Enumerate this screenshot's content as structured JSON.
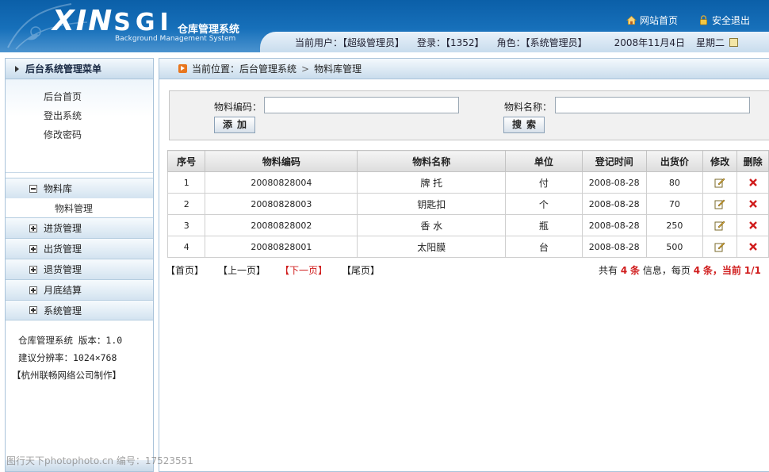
{
  "header": {
    "logo_mark": "XIN",
    "logo_mark_2": "SGI",
    "logo_sub": "Background Management System",
    "logo_cn": "仓库管理系统",
    "nav": {
      "home": "网站首页",
      "logout": "安全退出"
    },
    "info": {
      "user": "当前用户：【超级管理员】",
      "login": "登录：【1352】",
      "role": "角色：【系统管理员】",
      "date": "2008年11月4日",
      "weekday": "星期二"
    }
  },
  "sidebar": {
    "title": "后台系统管理菜单",
    "quick_links": [
      "后台首页",
      "登出系统",
      "修改密码"
    ],
    "menu": [
      {
        "label": "物料库",
        "expanded": true,
        "children": [
          "物料管理"
        ]
      },
      {
        "label": "进货管理",
        "expanded": false
      },
      {
        "label": "出货管理",
        "expanded": false
      },
      {
        "label": "退货管理",
        "expanded": false
      },
      {
        "label": "月底结算",
        "expanded": false
      },
      {
        "label": "系统管理",
        "expanded": false
      }
    ],
    "footer": [
      "仓库管理系统 版本：1.0",
      "建议分辨率：1024×768",
      "【杭州联畅网络公司制作】"
    ]
  },
  "breadcrumb": {
    "prefix": "当前位置：后台管理系统",
    "sep": ">",
    "current": "物料库管理"
  },
  "search": {
    "code_label": "物料编码：",
    "code_value": "",
    "name_label": "物料名称：",
    "name_value": "",
    "add_button": "添加",
    "search_button": "搜索"
  },
  "table": {
    "columns": [
      "序号",
      "物料编码",
      "物料名称",
      "单位",
      "登记时间",
      "出货价",
      "修改",
      "删除"
    ],
    "rows": [
      [
        "1",
        "20080828004",
        "牌 托",
        "付",
        "2008-08-28",
        "80"
      ],
      [
        "2",
        "20080828003",
        "钥匙扣",
        "个",
        "2008-08-28",
        "70"
      ],
      [
        "3",
        "20080828002",
        "香 水",
        "瓶",
        "2008-08-28",
        "250"
      ],
      [
        "4",
        "20080828001",
        "太阳膜",
        "台",
        "2008-08-28",
        "500"
      ]
    ]
  },
  "pager": {
    "first": "【首页】",
    "prev": "【上一页】",
    "next": "【下一页】",
    "last": "【尾页】",
    "info": {
      "total_prefix": "共有",
      "total": "4",
      "unit": "条",
      "info_text": "信息，每页",
      "per_page": "4",
      "unit2": "条，当前",
      "current": "1/1"
    }
  },
  "watermark": "图行天下photophoto.cn 编号：17523551",
  "colors": {
    "header": "#1770ba",
    "accent_red": "#d01c1c",
    "breadcrumb_icon": "#e8761e"
  }
}
